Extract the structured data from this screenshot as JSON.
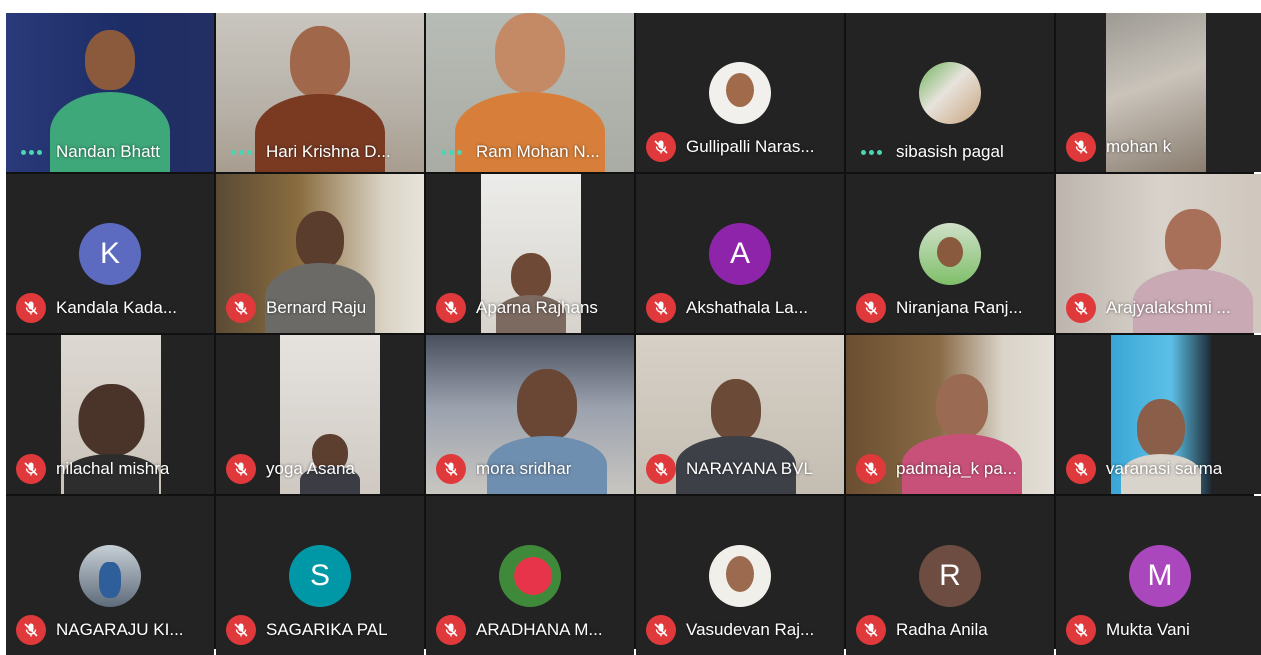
{
  "participants": [
    {
      "name": "Nandan Bhatt",
      "status": "speaking"
    },
    {
      "name": "Hari Krishna D...",
      "status": "speaking"
    },
    {
      "name": "Ram Mohan N...",
      "status": "speaking"
    },
    {
      "name": "Gullipalli Naras...",
      "status": "muted"
    },
    {
      "name": "sibasish pagal",
      "status": "speaking"
    },
    {
      "name": "mohan k",
      "status": "muted"
    },
    {
      "name": "Kandala Kada...",
      "status": "muted",
      "avatar_letter": "K",
      "avatar_color": "#5c6bc0"
    },
    {
      "name": "Bernard Raju",
      "status": "muted"
    },
    {
      "name": "Aparna Rajhans",
      "status": "muted"
    },
    {
      "name": "Akshathala La...",
      "status": "muted",
      "avatar_letter": "A",
      "avatar_color": "#8e24aa"
    },
    {
      "name": "Niranjana Ranj...",
      "status": "muted"
    },
    {
      "name": "Arajyalakshmi ...",
      "status": "muted"
    },
    {
      "name": "nilachal mishra",
      "status": "muted"
    },
    {
      "name": "yoga Asana",
      "status": "muted"
    },
    {
      "name": "mora sridhar",
      "status": "muted"
    },
    {
      "name": "NARAYANA BVL",
      "status": "muted"
    },
    {
      "name": "padmaja_k pa...",
      "status": "muted"
    },
    {
      "name": "varanasi sarma",
      "status": "muted"
    },
    {
      "name": "NAGARAJU KI...",
      "status": "muted"
    },
    {
      "name": "SAGARIKA PAL",
      "status": "muted",
      "avatar_letter": "S",
      "avatar_color": "#0097a7"
    },
    {
      "name": "ARADHANA M...",
      "status": "muted"
    },
    {
      "name": "Vasudevan Raj...",
      "status": "muted"
    },
    {
      "name": "Radha Anila",
      "status": "muted",
      "avatar_letter": "R",
      "avatar_color": "#6d4c41"
    },
    {
      "name": "Mukta Vani",
      "status": "muted",
      "avatar_letter": "M",
      "avatar_color": "#ab47bc"
    }
  ],
  "colors": {
    "muted_badge": "#e0393b",
    "speaking_accent": "#4ad6b2",
    "tile_bg": "#232323"
  },
  "icons": {
    "muted": "mic-off-icon",
    "speaking": "audio-dots-icon"
  }
}
